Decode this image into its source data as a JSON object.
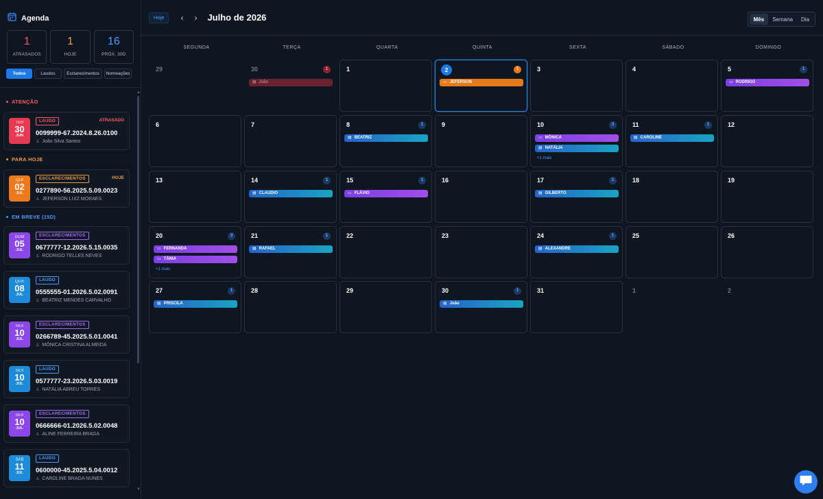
{
  "sidebar": {
    "title": "Agenda",
    "stats": [
      {
        "value": "1",
        "label": "ATRASADOS",
        "color": "#ff5a6a"
      },
      {
        "value": "1",
        "label": "HOJE",
        "color": "#f39a3c"
      },
      {
        "value": "16",
        "label": "PRÓX. 30D",
        "color": "#4d9bff"
      }
    ],
    "filters": [
      "Todos",
      "Laudos",
      "Esclarecimentos",
      "Nomeações"
    ],
    "sections": [
      {
        "title": "ATENÇÃO",
        "color": "#ff5a6a"
      },
      {
        "title": "PARA HOJE",
        "color": "#f39a3c"
      },
      {
        "title": "EM BREVE (15D)",
        "color": "#4d9bff"
      }
    ],
    "cards": [
      {
        "dow": "TER",
        "day": "30",
        "month": "JUN",
        "tag": "LAUDO",
        "tagColor": "#ff5a6a",
        "status": "ATRASADO",
        "statusColor": "#ff5a6a",
        "process": "0099999-67.2024.8.26.0100",
        "name": "João Silva Santos",
        "boxColor": "#e63a52"
      },
      {
        "dow": "QUI",
        "day": "02",
        "month": "JUL",
        "tag": "ESCLARECIMENTOS",
        "tagColor": "#f39a3c",
        "status": "HOJE",
        "statusColor": "#f39a3c",
        "process": "0277890-56.2025.5.09.0023",
        "name": "JEFERSON LUIZ MORAES",
        "boxColor": "#ec7a1c"
      },
      {
        "dow": "DOM",
        "day": "05",
        "month": "JUL",
        "tag": "ESCLARECIMENTOS",
        "tagColor": "#a66bf2",
        "status": "",
        "statusColor": "",
        "process": "0677777-12.2026.5.15.0035",
        "name": "RODRIGO TELLES NEVES",
        "boxColor": "#8c47e8"
      },
      {
        "dow": "QUA",
        "day": "08",
        "month": "JUL",
        "tag": "LAUDO",
        "tagColor": "#4d9bff",
        "status": "",
        "statusColor": "",
        "process": "0555555-01.2026.5.02.0091",
        "name": "BEATRIZ MENDES CARVALHO",
        "boxColor": "#1d8bd8"
      },
      {
        "dow": "SEX",
        "day": "10",
        "month": "JUL",
        "tag": "ESCLARECIMENTOS",
        "tagColor": "#a66bf2",
        "status": "",
        "statusColor": "",
        "process": "0266789-45.2025.5.01.0041",
        "name": "MÔNICA CRISTINA ALMEIDA",
        "boxColor": "#8c47e8"
      },
      {
        "dow": "SEX",
        "day": "10",
        "month": "JUL",
        "tag": "LAUDO",
        "tagColor": "#4d9bff",
        "status": "",
        "statusColor": "",
        "process": "0577777-23.2026.5.03.0019",
        "name": "NATÁLIA ABREU TORRES",
        "boxColor": "#1d8bd8"
      },
      {
        "dow": "SEX",
        "day": "10",
        "month": "JUL",
        "tag": "ESCLARECIMENTOS",
        "tagColor": "#a66bf2",
        "status": "",
        "statusColor": "",
        "process": "0666666-01.2026.5.02.0048",
        "name": "ALINE FERREIRA BRAGA",
        "boxColor": "#8c47e8"
      },
      {
        "dow": "SÁB",
        "day": "11",
        "month": "JUL",
        "tag": "LAUDO",
        "tagColor": "#4d9bff",
        "status": "",
        "statusColor": "",
        "process": "0600000-45.2025.5.04.0012",
        "name": "CAROLINE BRAGA NUNES",
        "boxColor": "#1d8bd8"
      }
    ]
  },
  "toolbar": {
    "today": "Hoje",
    "prev": "‹",
    "next": "›",
    "title": "Julho de 2026",
    "views": [
      "Mês",
      "Semana",
      "Dia"
    ],
    "activeView": "Mês"
  },
  "weekdays": [
    "SEGUNDA",
    "TERÇA",
    "QUARTA",
    "QUINTA",
    "SEXTA",
    "SÁBADO",
    "DOMINGO"
  ],
  "weeks": [
    [
      {
        "d": "29",
        "out": true
      },
      {
        "d": "30",
        "out": true,
        "count": "1",
        "countType": "red",
        "events": [
          {
            "label": "João",
            "type": "past",
            "icon": "laudo"
          }
        ]
      },
      {
        "d": "1"
      },
      {
        "d": "2",
        "today": true,
        "count": "1",
        "countType": "orange",
        "events": [
          {
            "label": "JEFERSON",
            "type": "jef",
            "icon": "escl"
          }
        ]
      },
      {
        "d": "3"
      },
      {
        "d": "4"
      },
      {
        "d": "5",
        "count": "1",
        "countType": "blue",
        "events": [
          {
            "label": "RODRIGO",
            "type": "escl",
            "icon": "escl"
          }
        ]
      }
    ],
    [
      {
        "d": "6"
      },
      {
        "d": "7"
      },
      {
        "d": "8",
        "count": "1",
        "countType": "blue",
        "events": [
          {
            "label": "BEATRIZ",
            "type": "laudo",
            "icon": "laudo"
          }
        ]
      },
      {
        "d": "9"
      },
      {
        "d": "10",
        "count": "3",
        "countType": "blue",
        "events": [
          {
            "label": "MÔNICA",
            "type": "escl",
            "icon": "escl"
          },
          {
            "label": "NATÁLIA",
            "type": "laudo",
            "icon": "laudo"
          }
        ],
        "more": "+1 mais"
      },
      {
        "d": "11",
        "count": "1",
        "countType": "blue",
        "events": [
          {
            "label": "CAROLINE",
            "type": "laudo",
            "icon": "laudo"
          }
        ]
      },
      {
        "d": "12"
      }
    ],
    [
      {
        "d": "13"
      },
      {
        "d": "14",
        "count": "1",
        "countType": "blue",
        "events": [
          {
            "label": "CLAUDIO",
            "type": "laudo",
            "icon": "laudo"
          }
        ]
      },
      {
        "d": "15",
        "count": "1",
        "countType": "blue",
        "events": [
          {
            "label": "FLÁVIO",
            "type": "escl",
            "icon": "escl"
          }
        ]
      },
      {
        "d": "16"
      },
      {
        "d": "17",
        "count": "1",
        "countType": "blue",
        "events": [
          {
            "label": "GILBERTO",
            "type": "laudo",
            "icon": "laudo"
          }
        ]
      },
      {
        "d": "18"
      },
      {
        "d": "19"
      }
    ],
    [
      {
        "d": "20",
        "count": "3",
        "countType": "blue",
        "events": [
          {
            "label": "FERNANDA",
            "type": "escl",
            "icon": "escl"
          },
          {
            "label": "TÂNIA",
            "type": "escl",
            "icon": "escl"
          }
        ],
        "more": "+1 mais"
      },
      {
        "d": "21",
        "count": "1",
        "countType": "blue",
        "events": [
          {
            "label": "RAFAEL",
            "type": "laudo",
            "icon": "laudo"
          }
        ]
      },
      {
        "d": "22"
      },
      {
        "d": "23"
      },
      {
        "d": "24",
        "count": "1",
        "countType": "blue",
        "events": [
          {
            "label": "ALEXANDRE",
            "type": "laudo",
            "icon": "laudo"
          }
        ]
      },
      {
        "d": "25"
      },
      {
        "d": "26"
      }
    ],
    [
      {
        "d": "27",
        "count": "1",
        "countType": "blue",
        "events": [
          {
            "label": "PRISCILA",
            "type": "laudo",
            "icon": "laudo"
          }
        ]
      },
      {
        "d": "28"
      },
      {
        "d": "29"
      },
      {
        "d": "30",
        "count": "1",
        "countType": "blue",
        "events": [
          {
            "label": "João",
            "type": "laudo",
            "icon": "laudo"
          }
        ]
      },
      {
        "d": "31"
      },
      {
        "d": "1",
        "out": true
      },
      {
        "d": "2",
        "out": true
      }
    ]
  ]
}
